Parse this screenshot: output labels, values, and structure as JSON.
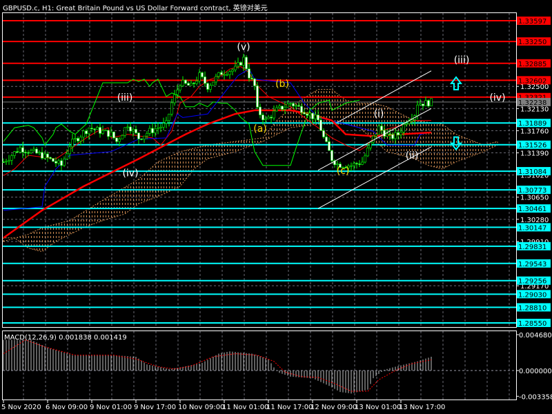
{
  "window": {
    "title": "GBPUSD.c, H1:  Great Britain Pound vs US Dollar Forward contract, 英镑对美元"
  },
  "colors": {
    "background": "#000000",
    "grid": "#9a9aa8",
    "bull": "#00ff00",
    "bear": "#ffffff",
    "resistance": "#ff0000",
    "support": "#00ffff",
    "current": "#808080",
    "wave_white": "#ffffff",
    "wave_yellow": "#ffd700",
    "cloud_a": "#f4a460",
    "cloud_b": "#e8e8e8",
    "macd_hist": "#c0c0c0",
    "macd_signal": "#ff0000",
    "kijun": "#ff0000",
    "tenkan": "#0000ff",
    "chikou": "#00ff00"
  },
  "price_axis": {
    "ticks": [
      "1.32500",
      "1.32130",
      "1.31760",
      "1.31390",
      "1.31020",
      "1.30650",
      "1.30280",
      "1.29910",
      "1.29170"
    ],
    "resistance_levels": [
      "1.33597",
      "1.33250",
      "1.32885",
      "1.32602",
      "1.32321"
    ],
    "support_levels": [
      "1.31889",
      "1.31526",
      "1.31084",
      "1.30773",
      "1.30461",
      "1.30147",
      "1.29831",
      "1.29543",
      "1.29256",
      "1.29030",
      "1.28810",
      "1.28550"
    ],
    "current_price": "1.32238"
  },
  "time_axis": {
    "labels": [
      "5 Nov 2020",
      "6 Nov 09:00",
      "9 Nov 01:00",
      "9 Nov 17:00",
      "10 Nov 09:00",
      "11 Nov 01:00",
      "11 Nov 17:00",
      "12 Nov 09:00",
      "13 Nov 01:00",
      "13 Nov 17:00"
    ],
    "hours_between_labels": 16
  },
  "price_path": [
    [
      0,
      1.3124
    ],
    [
      6,
      1.3147
    ],
    [
      14,
      1.3135
    ],
    [
      21,
      1.3118
    ],
    [
      24,
      1.3152
    ],
    [
      31,
      1.3181
    ],
    [
      39,
      1.317
    ],
    [
      41,
      1.3158
    ],
    [
      45,
      1.3187
    ],
    [
      49,
      1.3164
    ],
    [
      53,
      1.3175
    ],
    [
      59,
      1.3187
    ],
    [
      61,
      1.3222
    ],
    [
      64,
      1.3256
    ],
    [
      68,
      1.325
    ],
    [
      71,
      1.3268
    ],
    [
      74,
      1.325
    ],
    [
      79,
      1.3273
    ],
    [
      84,
      1.3279
    ],
    [
      87,
      1.3296
    ],
    [
      89,
      1.3268
    ],
    [
      91,
      1.325
    ],
    [
      92,
      1.321
    ],
    [
      95,
      1.3193
    ],
    [
      99,
      1.321
    ],
    [
      104,
      1.3222
    ],
    [
      109,
      1.321
    ],
    [
      114,
      1.3193
    ],
    [
      116,
      1.3164
    ],
    [
      119,
      1.3129
    ],
    [
      121,
      1.312
    ],
    [
      126,
      1.3118
    ],
    [
      130,
      1.3124
    ],
    [
      134,
      1.3164
    ],
    [
      136,
      1.3181
    ],
    [
      140,
      1.3164
    ],
    [
      143,
      1.317
    ],
    [
      146,
      1.3193
    ],
    [
      149,
      1.3204
    ],
    [
      150,
      1.3222
    ],
    [
      153,
      1.3222
    ],
    [
      155,
      1.3224
    ]
  ],
  "indicators": {
    "kijun": [
      [
        0,
        1.2997
      ],
      [
        14,
        1.3043
      ],
      [
        29,
        1.3083
      ],
      [
        49,
        1.3129
      ],
      [
        66,
        1.317
      ],
      [
        74,
        1.3187
      ],
      [
        84,
        1.3204
      ],
      [
        91,
        1.321
      ],
      [
        104,
        1.321
      ],
      [
        111,
        1.3204
      ],
      [
        119,
        1.3193
      ],
      [
        124,
        1.317
      ],
      [
        134,
        1.3167
      ],
      [
        144,
        1.317
      ],
      [
        155,
        1.3173
      ]
    ],
    "tenkan_blue": [
      [
        0,
        1.3043
      ],
      [
        14,
        1.3049
      ],
      [
        15,
        1.3083
      ],
      [
        19,
        1.3112
      ],
      [
        24,
        1.3135
      ],
      [
        39,
        1.3141
      ],
      [
        49,
        1.3162
      ],
      [
        59,
        1.3164
      ],
      [
        63,
        1.3204
      ],
      [
        65,
        1.3198
      ],
      [
        74,
        1.3204
      ],
      [
        81,
        1.3245
      ],
      [
        85,
        1.3268
      ],
      [
        89,
        1.3279
      ],
      [
        91,
        1.3262
      ],
      [
        99,
        1.3258
      ],
      [
        104,
        1.3256
      ],
      [
        109,
        1.3222
      ],
      [
        114,
        1.3198
      ],
      [
        124,
        1.3187
      ],
      [
        134,
        1.3175
      ],
      [
        139,
        1.3152
      ],
      [
        149,
        1.3152
      ],
      [
        151,
        1.317
      ],
      [
        155,
        1.3173
      ]
    ],
    "thin_red": [
      [
        0,
        1.3101
      ],
      [
        4,
        1.3112
      ],
      [
        9,
        1.3135
      ],
      [
        19,
        1.3129
      ],
      [
        21,
        1.3135
      ],
      [
        30,
        1.3164
      ],
      [
        34,
        1.3175
      ],
      [
        38,
        1.3181
      ],
      [
        39,
        1.3164
      ],
      [
        45,
        1.317
      ],
      [
        54,
        1.3164
      ],
      [
        57,
        1.3152
      ],
      [
        61,
        1.3175
      ],
      [
        64,
        1.3222
      ],
      [
        68,
        1.3233
      ],
      [
        71,
        1.325
      ],
      [
        75,
        1.3262
      ],
      [
        79,
        1.3268
      ],
      [
        82,
        1.3279
      ],
      [
        86,
        1.3283
      ],
      [
        89,
        1.3273
      ],
      [
        91,
        1.3256
      ],
      [
        96,
        1.3233
      ],
      [
        104,
        1.3216
      ],
      [
        109,
        1.3198
      ],
      [
        114,
        1.3181
      ],
      [
        119,
        1.3164
      ],
      [
        124,
        1.3152
      ],
      [
        129,
        1.3143
      ],
      [
        132,
        1.3152
      ],
      [
        136,
        1.3175
      ],
      [
        141,
        1.3181
      ],
      [
        146,
        1.3187
      ],
      [
        149,
        1.3193
      ],
      [
        155,
        1.3193
      ]
    ],
    "chikou": [
      [
        0,
        1.3158
      ],
      [
        4,
        1.3181
      ],
      [
        9,
        1.3185
      ],
      [
        11,
        1.3181
      ],
      [
        14,
        1.3164
      ],
      [
        15,
        1.3152
      ],
      [
        18,
        1.317
      ],
      [
        19,
        1.3181
      ],
      [
        21,
        1.3187
      ],
      [
        24,
        1.3175
      ],
      [
        26,
        1.317
      ],
      [
        30,
        1.3187
      ],
      [
        36,
        1.3256
      ],
      [
        41,
        1.3256
      ],
      [
        45,
        1.3256
      ],
      [
        47,
        1.3262
      ],
      [
        49,
        1.3258
      ],
      [
        51,
        1.3262
      ],
      [
        53,
        1.325
      ],
      [
        54,
        1.3256
      ],
      [
        56,
        1.3262
      ],
      [
        59,
        1.3233
      ],
      [
        61,
        1.3239
      ],
      [
        64,
        1.3233
      ],
      [
        66,
        1.3216
      ],
      [
        69,
        1.3216
      ],
      [
        71,
        1.3222
      ],
      [
        74,
        1.3216
      ],
      [
        76,
        1.3224
      ],
      [
        79,
        1.3222
      ],
      [
        81,
        1.3222
      ],
      [
        84,
        1.321
      ],
      [
        86,
        1.3198
      ],
      [
        89,
        1.3187
      ],
      [
        91,
        1.3141
      ],
      [
        94,
        1.3118
      ],
      [
        104,
        1.3118
      ],
      [
        106,
        1.3147
      ],
      [
        109,
        1.3187
      ],
      [
        111,
        1.321
      ],
      [
        114,
        1.3222
      ],
      [
        118,
        1.3227
      ],
      [
        119,
        1.321
      ],
      [
        124,
        1.3222
      ],
      [
        129,
        1.3227
      ]
    ],
    "cloud_upper": [
      [
        0,
        1.2991
      ],
      [
        9,
        1.3003
      ],
      [
        14,
        1.3014
      ],
      [
        24,
        1.3026
      ],
      [
        36,
        1.306
      ],
      [
        49,
        1.3095
      ],
      [
        56,
        1.3124
      ],
      [
        64,
        1.3141
      ],
      [
        74,
        1.3152
      ],
      [
        84,
        1.3158
      ],
      [
        94,
        1.3164
      ],
      [
        99,
        1.3193
      ],
      [
        106,
        1.3222
      ],
      [
        114,
        1.3245
      ],
      [
        119,
        1.3245
      ],
      [
        124,
        1.3227
      ],
      [
        129,
        1.3222
      ],
      [
        134,
        1.3222
      ],
      [
        139,
        1.3216
      ],
      [
        144,
        1.3204
      ],
      [
        149,
        1.3193
      ],
      [
        159,
        1.3187
      ],
      [
        164,
        1.317
      ],
      [
        174,
        1.3152
      ],
      [
        179,
        1.3158
      ]
    ],
    "cloud_lower": [
      [
        179,
        1.3152
      ],
      [
        174,
        1.3141
      ],
      [
        164,
        1.3124
      ],
      [
        159,
        1.3112
      ],
      [
        154,
        1.3118
      ],
      [
        149,
        1.3129
      ],
      [
        139,
        1.3141
      ],
      [
        129,
        1.3181
      ],
      [
        124,
        1.3187
      ],
      [
        114,
        1.3187
      ],
      [
        104,
        1.3181
      ],
      [
        94,
        1.3158
      ],
      [
        84,
        1.3141
      ],
      [
        74,
        1.3129
      ],
      [
        69,
        1.3112
      ],
      [
        64,
        1.3083
      ],
      [
        56,
        1.3066
      ],
      [
        49,
        1.3054
      ],
      [
        44,
        1.3037
      ],
      [
        36,
        1.3026
      ],
      [
        29,
        1.3014
      ],
      [
        19,
        1.2991
      ],
      [
        14,
        1.2974
      ],
      [
        9,
        1.298
      ],
      [
        4,
        1.2997
      ],
      [
        0,
        1.2997
      ]
    ]
  },
  "channel_lines": [
    [
      [
        121,
        1.319
      ],
      [
        155,
        1.3276
      ]
    ],
    [
      [
        114,
        1.311
      ],
      [
        155,
        1.3213
      ]
    ],
    [
      [
        114,
        1.3046
      ],
      [
        155,
        1.3149
      ]
    ]
  ],
  "wave_labels": [
    {
      "text": "(v)",
      "hour": 87,
      "price": 1.3311,
      "color": "white"
    },
    {
      "text": "(iii)",
      "hour": 44,
      "price": 1.3226,
      "color": "white"
    },
    {
      "text": "(iv)",
      "hour": 46,
      "price": 1.31,
      "color": "white"
    },
    {
      "text": "(i)",
      "hour": 136,
      "price": 1.3199,
      "color": "white"
    },
    {
      "text": "(ii)",
      "hour": 148,
      "price": 1.3129,
      "color": "white"
    },
    {
      "text": "(iii)",
      "hour": 166,
      "price": 1.3289,
      "color": "white"
    },
    {
      "text": "(iv)",
      "hour": 179,
      "price": 1.3226,
      "color": "white"
    },
    {
      "text": "(a)",
      "hour": 93,
      "price": 1.3174,
      "color": "yellow"
    },
    {
      "text": "(b)",
      "hour": 101,
      "price": 1.3249,
      "color": "yellow"
    },
    {
      "text": "(c)",
      "hour": 123,
      "price": 1.3104,
      "color": "yellow"
    }
  ],
  "arrows": [
    {
      "dir": "up",
      "hour": 164,
      "price": 1.3255
    },
    {
      "dir": "down",
      "hour": 164,
      "price": 1.3155
    }
  ],
  "macd": {
    "label": "MACD(12,26,9) 0.001838 0.001419",
    "scale_labels": [
      "0.004680",
      "0.000000",
      "-0.003358"
    ],
    "max": 0.00468,
    "min": -0.003358,
    "histogram": [
      [
        0,
        0.004
      ],
      [
        10,
        0.004
      ],
      [
        16,
        0.003
      ],
      [
        25,
        0.002
      ],
      [
        40,
        0.002
      ],
      [
        48,
        0.0018
      ],
      [
        52,
        0.0008
      ],
      [
        60,
        0.0002
      ],
      [
        64,
        0.0004
      ],
      [
        72,
        0.001
      ],
      [
        78,
        0.0022
      ],
      [
        82,
        0.0025
      ],
      [
        90,
        0.0022
      ],
      [
        96,
        0.0015
      ],
      [
        98,
        0.0004
      ],
      [
        100,
        -0.0003
      ],
      [
        104,
        -0.0008
      ],
      [
        112,
        -0.001
      ],
      [
        118,
        -0.002
      ],
      [
        122,
        -0.0028
      ],
      [
        126,
        -0.003
      ],
      [
        132,
        -0.0025
      ],
      [
        134,
        -0.001
      ],
      [
        138,
        0.0001
      ],
      [
        142,
        0.0005
      ],
      [
        150,
        0.0012
      ],
      [
        155,
        0.0018
      ]
    ],
    "signal": [
      [
        0,
        0.0022
      ],
      [
        8,
        0.004
      ],
      [
        14,
        0.0032
      ],
      [
        26,
        0.002
      ],
      [
        40,
        0.002
      ],
      [
        48,
        0.0015
      ],
      [
        56,
        0.0005
      ],
      [
        62,
        0.0002
      ],
      [
        68,
        0.0006
      ],
      [
        76,
        0.0018
      ],
      [
        84,
        0.0022
      ],
      [
        92,
        0.002
      ],
      [
        98,
        0.0012
      ],
      [
        102,
        -0.0002
      ],
      [
        108,
        -0.0008
      ],
      [
        114,
        -0.0009
      ],
      [
        120,
        -0.0017
      ],
      [
        126,
        -0.0027
      ],
      [
        132,
        -0.0027
      ],
      [
        136,
        -0.0012
      ],
      [
        142,
        0.0
      ],
      [
        148,
        0.0009
      ],
      [
        155,
        0.0014
      ]
    ]
  }
}
